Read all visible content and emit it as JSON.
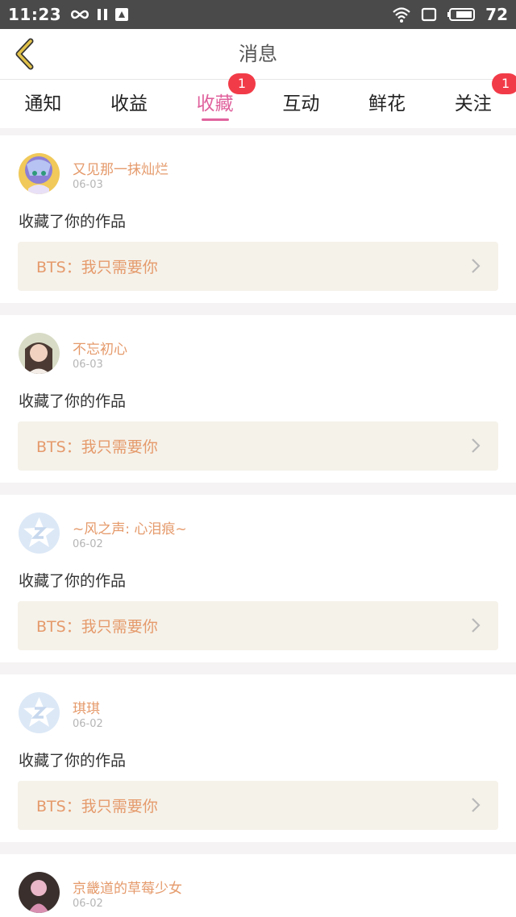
{
  "status_bar": {
    "time": "11:23",
    "battery": "72"
  },
  "header": {
    "title": "消息"
  },
  "tabs": [
    {
      "label": "通知"
    },
    {
      "label": "收益"
    },
    {
      "label": "收藏",
      "badge": "1"
    },
    {
      "label": "互动"
    },
    {
      "label": "鲜花"
    },
    {
      "label": "关注",
      "badge": "1"
    }
  ],
  "items": [
    {
      "user": "又见那一抹灿烂",
      "date": "06-03",
      "action": "收藏了你的作品",
      "work": "BTS：我只需要你",
      "avatar": "anime-avatar"
    },
    {
      "user": "不忘初心",
      "date": "06-03",
      "action": "收藏了你的作品",
      "work": "BTS：我只需要你",
      "avatar": "photo-avatar"
    },
    {
      "user": "~风之声: 心泪痕~",
      "date": "06-02",
      "action": "收藏了你的作品",
      "work": "BTS：我只需要你",
      "avatar": "default-avatar"
    },
    {
      "user": "琪琪",
      "date": "06-02",
      "action": "收藏了你的作品",
      "work": "BTS：我只需要你",
      "avatar": "default-avatar"
    },
    {
      "user": "京畿道的草莓少女",
      "date": "06-02",
      "avatar": "photo-avatar"
    }
  ],
  "colors": {
    "accent": "#e0629d",
    "badge": "#f23b48",
    "username": "#e59a6b",
    "work_bg": "#f5f2ea"
  }
}
